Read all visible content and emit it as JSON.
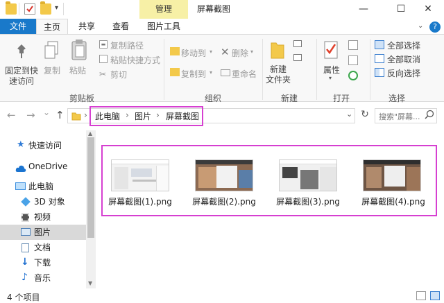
{
  "window": {
    "title": "屏幕截图",
    "context_tab": "管理",
    "controls": {
      "minimize": "—",
      "maximize": "☐",
      "close": "✕"
    }
  },
  "tabs": {
    "file": "文件",
    "items": [
      "主页",
      "共享",
      "查看",
      "图片工具"
    ]
  },
  "ribbon": {
    "pin_label_1": "固定到快",
    "pin_label_2": "速访问",
    "copy": "复制",
    "paste": "粘贴",
    "copy_path": "复制路径",
    "paste_shortcut": "粘贴快捷方式",
    "cut": "剪切",
    "move_to": "移动到",
    "delete": "删除",
    "copy_to": "复制到",
    "rename": "重命名",
    "new_folder_1": "新建",
    "new_folder_2": "文件夹",
    "properties": "属性",
    "select_all": "全部选择",
    "select_none": "全部取消",
    "invert_selection": "反向选择",
    "groups": {
      "clipboard": "剪贴板",
      "organize": "组织",
      "new": "新建",
      "open": "打开",
      "select": "选择"
    }
  },
  "address": {
    "crumbs": [
      "此电脑",
      "图片",
      "屏幕截图"
    ],
    "separator": "›",
    "search_placeholder": "搜索\"屏幕...",
    "back": "←",
    "forward": "→",
    "up": "↑",
    "dropdown": "⌄",
    "refresh": "↻"
  },
  "nav": {
    "items": [
      {
        "label": "快速访问",
        "icon": "star-icon",
        "color": "#2f7bd6"
      },
      {
        "label": "OneDrive",
        "icon": "cloud-icon",
        "color": "#1b74d0"
      },
      {
        "label": "此电脑",
        "icon": "computer-icon",
        "color": "#3b8ede"
      },
      {
        "label": "3D 对象",
        "icon": "cube-icon",
        "color": "#4aa3e8"
      },
      {
        "label": "视频",
        "icon": "video-icon",
        "color": "#555555"
      },
      {
        "label": "图片",
        "icon": "pictures-icon",
        "color": "#4c7fb8"
      },
      {
        "label": "文档",
        "icon": "document-icon",
        "color": "#6a8fb5"
      },
      {
        "label": "下载",
        "icon": "download-icon",
        "color": "#1e6fd0"
      },
      {
        "label": "音乐",
        "icon": "music-icon",
        "color": "#1e6fd0"
      }
    ],
    "selected_index": 5
  },
  "files": [
    {
      "name": "屏幕截图(1).png"
    },
    {
      "name": "屏幕截图(2).png"
    },
    {
      "name": "屏幕截图(3).png"
    },
    {
      "name": "屏幕截图(4).png"
    }
  ],
  "status": {
    "item_count": "4 个项目"
  },
  "colors": {
    "accent": "#1979ca",
    "highlight_box": "#d63fd1",
    "context_tab": "#f7f0a6"
  }
}
